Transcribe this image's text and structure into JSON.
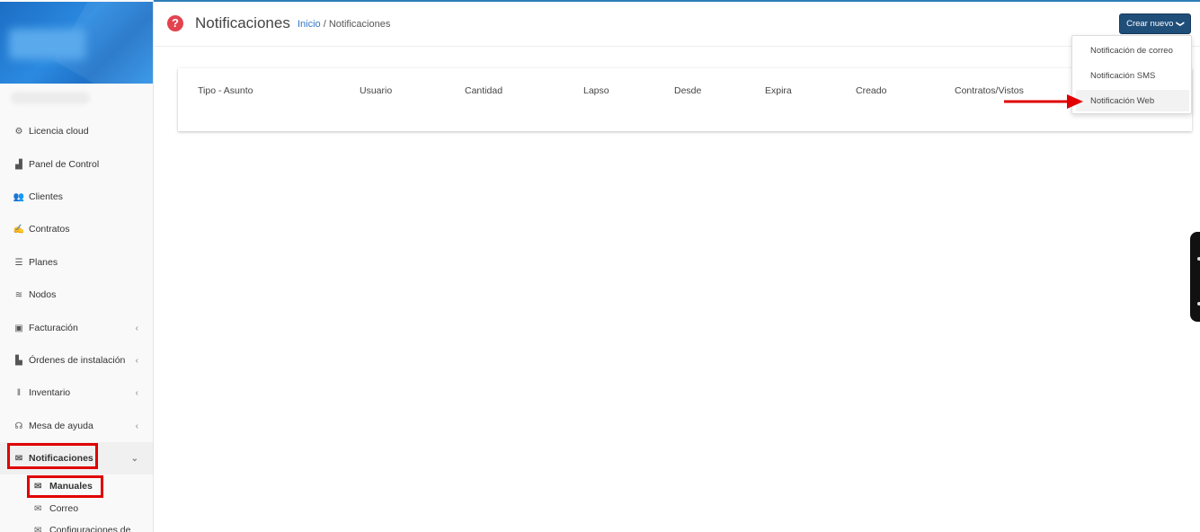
{
  "sidebar": {
    "items": [
      {
        "label": "Licencia cloud",
        "icon": "cubes-icon",
        "glyph": "⚙"
      },
      {
        "label": "Panel de Control",
        "icon": "area-chart-icon",
        "glyph": "▟"
      },
      {
        "label": "Clientes",
        "icon": "users-icon",
        "glyph": "👥"
      },
      {
        "label": "Contratos",
        "icon": "handshake-icon",
        "glyph": "✍"
      },
      {
        "label": "Planes",
        "icon": "server-icon",
        "glyph": "☰"
      },
      {
        "label": "Nodos",
        "icon": "wifi-icon",
        "glyph": "≋"
      },
      {
        "label": "Facturación",
        "icon": "money-icon",
        "glyph": "▣"
      },
      {
        "label": "Órdenes de instalación",
        "icon": "truck-icon",
        "glyph": "▙"
      },
      {
        "label": "Inventario",
        "icon": "barcode-icon",
        "glyph": "‖"
      },
      {
        "label": "Mesa de ayuda",
        "icon": "headset-icon",
        "glyph": "☊"
      },
      {
        "label": "Notificaciones",
        "icon": "envelope-icon",
        "glyph": "✉"
      }
    ],
    "submenu": [
      {
        "label": "Manuales",
        "icon": "envelope-icon",
        "glyph": "✉"
      },
      {
        "label": "Correo",
        "icon": "envelope-icon",
        "glyph": "✉"
      },
      {
        "label": "Configuraciones de",
        "icon": "envelope-icon",
        "glyph": "✉"
      }
    ],
    "chevron_left": "‹",
    "chevron_down": "⌄"
  },
  "header": {
    "title": "Notificaciones",
    "breadcrumb_home": "Inicio",
    "breadcrumb_sep": " / ",
    "breadcrumb_current": "Notificaciones",
    "help_glyph": "?",
    "create_button": "Crear nuevo",
    "create_caret": "❯"
  },
  "dropdown": {
    "items": [
      "Notificación de correo",
      "Notificación SMS",
      "Notificación Web"
    ]
  },
  "table": {
    "columns": [
      "Tipo - Asunto",
      "Usuario",
      "Cantidad",
      "Lapso",
      "Desde",
      "Expira",
      "Creado",
      "Contratos/Vistos"
    ]
  },
  "colors": {
    "accent": "#1f4e79",
    "highlight": "#e00000",
    "help": "#e2434f",
    "link": "#2f78c4"
  }
}
